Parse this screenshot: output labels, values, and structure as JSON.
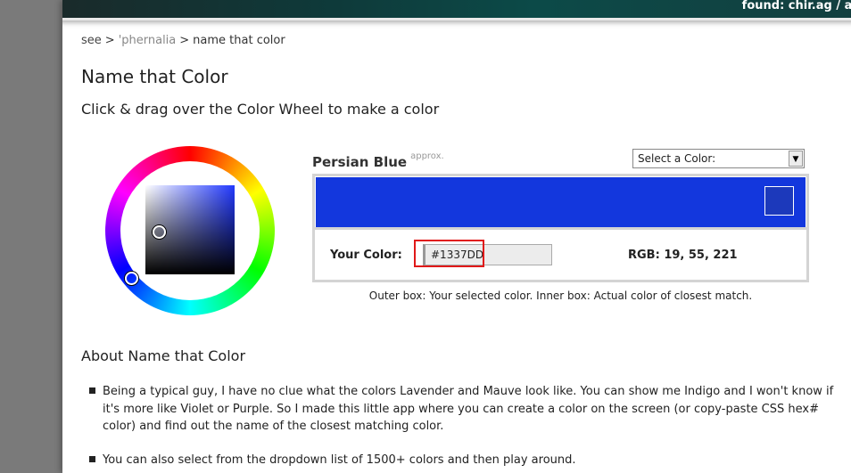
{
  "banner": {
    "text": "found: chir.ag / art"
  },
  "breadcrumb": {
    "items": [
      "see",
      "'phernalia",
      "name that color"
    ],
    "separator": ">"
  },
  "page": {
    "title": "Name that Color",
    "subtitle": "Click & drag over the Color Wheel to make a color"
  },
  "result": {
    "color_name": "Persian Blue",
    "approx_label": "approx.",
    "selected_hex_color": "#1337DD",
    "match_hex_color": "#1C39BB"
  },
  "select": {
    "label": "Select a Color:",
    "arrow_icon": "chevron-down-icon"
  },
  "your_color": {
    "label": "Your Color:",
    "hex_value": "#1337DD",
    "rgb_readout": "RGB: 19, 55, 221",
    "highlight_color": "#e01818"
  },
  "caption": "Outer box: Your selected color. Inner box: Actual color of closest match.",
  "about": {
    "heading": "About Name that Color",
    "paragraphs": [
      "Being a typical guy, I have no clue what the colors Lavender and Mauve look like. You can show me Indigo and I won't know if it's more like Violet or Purple. So I made this little app where you can create a color on the screen (or copy-paste CSS hex# color) and find out the name of the closest matching color.",
      "You can also select from the dropdown list of 1500+ colors and then play around."
    ]
  }
}
